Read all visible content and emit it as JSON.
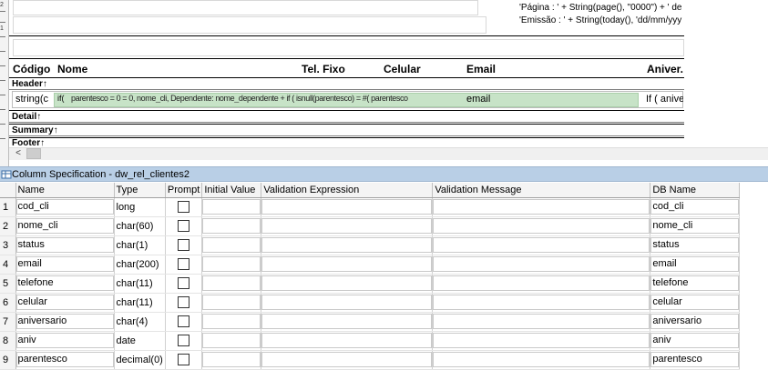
{
  "designer": {
    "ruler_numbers": [
      "2",
      "1"
    ],
    "page_expr": "'Página : ' + String(page(), \"0000\") + ' de",
    "emissao_expr": "'Emissão : ' + String(today(), 'dd/mm/yyy",
    "headers": {
      "codigo": "Código",
      "nome": "Nome",
      "tel_fixo": "Tel. Fixo",
      "celular": "Celular",
      "email": "Email",
      "aniver": "Aniver."
    },
    "bands": {
      "header": "Header",
      "detail": "Detail",
      "summary": "Summary",
      "footer": "Footer",
      "arrow": "↑"
    },
    "detail_cells": {
      "string_c": "string(c",
      "if1": "if(",
      "overlap": "parentesco = 0 = 0, nome_cli, Dependente: nome_dependente  +  if ( isnull(parentesco) = #( parentesco",
      "if_aniver": "If ( anive",
      "email_field": "email"
    },
    "scroll_left": "<"
  },
  "panel": {
    "title": "Column Specification - dw_rel_clientes2",
    "columns": [
      "Name",
      "Type",
      "Prompt",
      "Initial Value",
      "Validation Expression",
      "Validation Message",
      "DB Name"
    ],
    "rows": [
      {
        "n": "1",
        "name": "cod_cli",
        "type": "long",
        "db": "cod_cli"
      },
      {
        "n": "2",
        "name": "nome_cli",
        "type": "char(60)",
        "db": "nome_cli"
      },
      {
        "n": "3",
        "name": "status",
        "type": "char(1)",
        "db": "status"
      },
      {
        "n": "4",
        "name": "email",
        "type": "char(200)",
        "db": "email"
      },
      {
        "n": "5",
        "name": "telefone",
        "type": "char(11)",
        "db": "telefone"
      },
      {
        "n": "6",
        "name": "celular",
        "type": "char(11)",
        "db": "celular"
      },
      {
        "n": "7",
        "name": "aniversario",
        "type": "char(4)",
        "db": "aniversario"
      },
      {
        "n": "8",
        "name": "aniv",
        "type": "date",
        "db": "aniv"
      },
      {
        "n": "9",
        "name": "parentesco",
        "type": "decimal(0)",
        "db": "parentesco"
      }
    ]
  },
  "colors": {
    "title_bar": "#b9cfe6",
    "detail_highlight": "#c7e3c7"
  }
}
